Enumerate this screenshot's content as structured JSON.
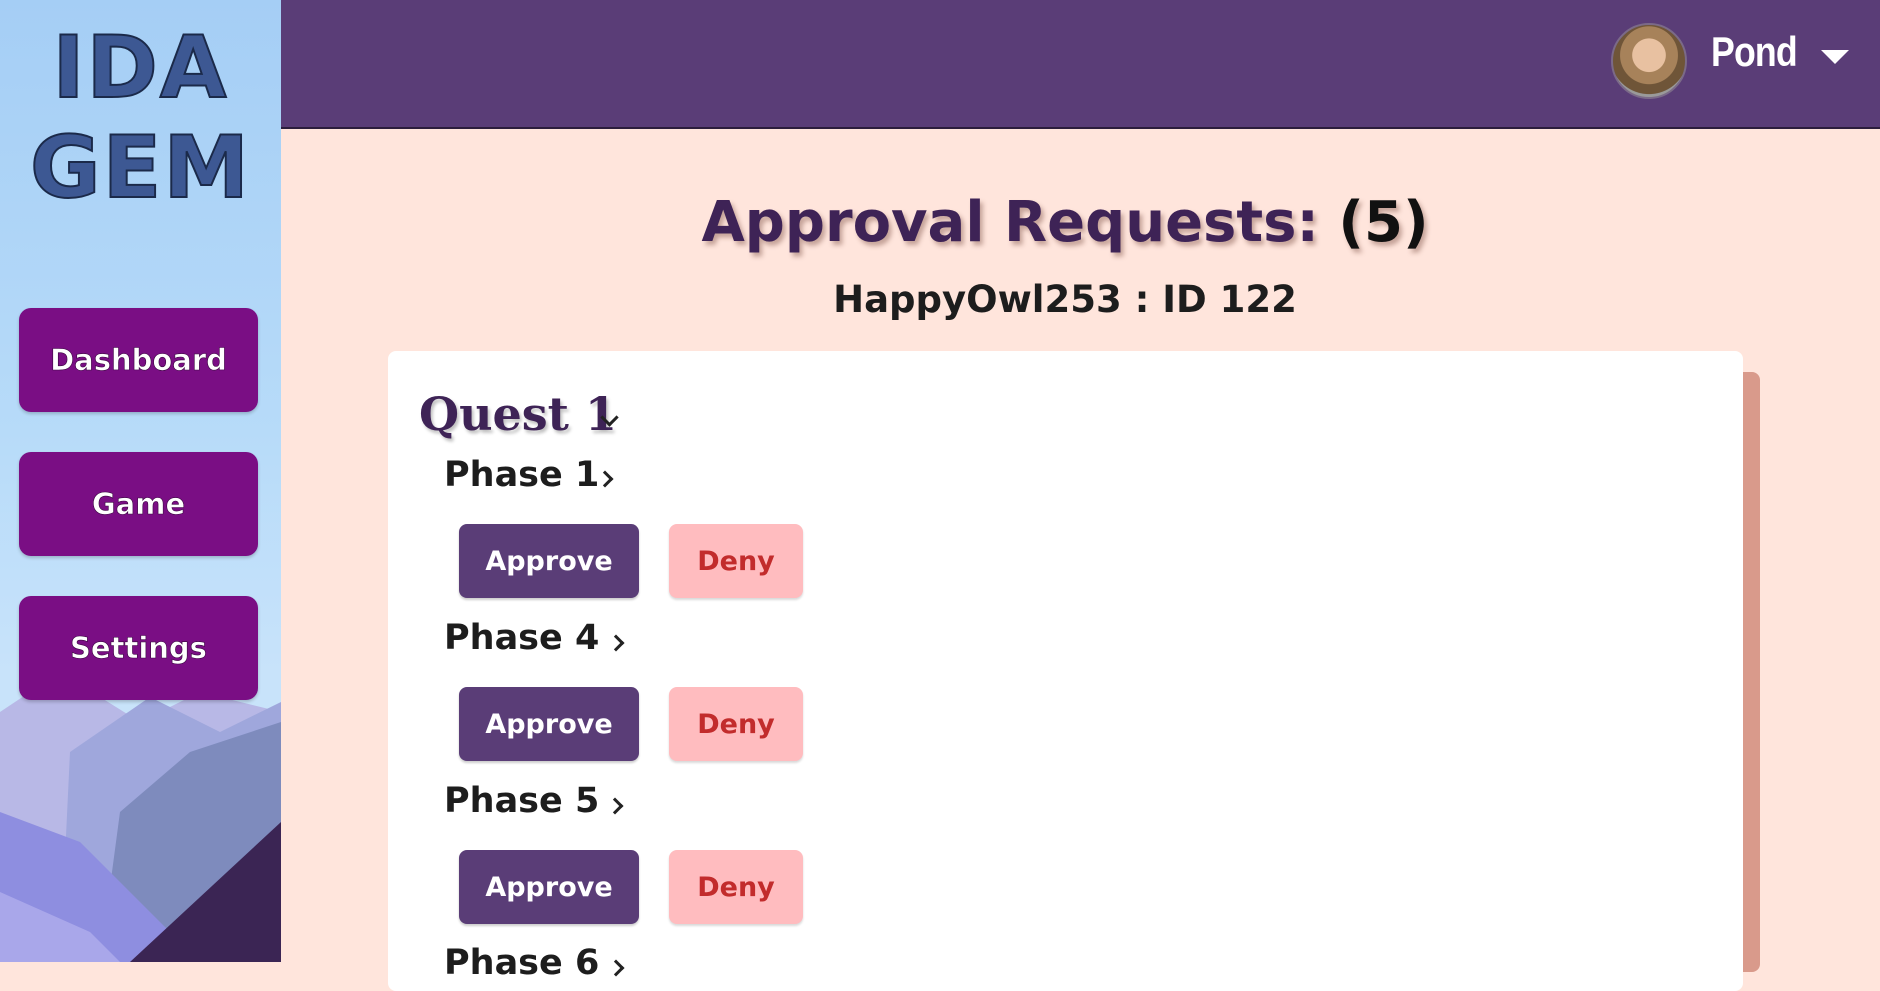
{
  "logo": {
    "line1": "IDA",
    "line2": "GEM"
  },
  "sidebar": {
    "items": [
      {
        "label": "Dashboard"
      },
      {
        "label": "Game"
      },
      {
        "label": "Settings"
      }
    ]
  },
  "header": {
    "username": "Pond"
  },
  "main": {
    "title_label": "Approval Requests:",
    "title_count": "(5)",
    "subtitle": "HappyOwl253 : ID 122",
    "quest": {
      "title": "Quest 1"
    },
    "phases": [
      {
        "label": "Phase 1",
        "approve": "Approve",
        "deny": "Deny"
      },
      {
        "label": "Phase 4",
        "approve": "Approve",
        "deny": "Deny"
      },
      {
        "label": "Phase 5",
        "approve": "Approve",
        "deny": "Deny"
      },
      {
        "label": "Phase 6"
      }
    ]
  },
  "colors": {
    "topbar": "#5a3d77",
    "nav_button": "#7a0e84",
    "approve": "#5a3d77",
    "deny_bg": "#ffbcbf",
    "deny_text": "#c22c2c",
    "page_bg": "#ffe5dc"
  },
  "icons": [
    "chevron-down-icon",
    "chevron-right-icon",
    "caret-down-icon",
    "avatar"
  ]
}
